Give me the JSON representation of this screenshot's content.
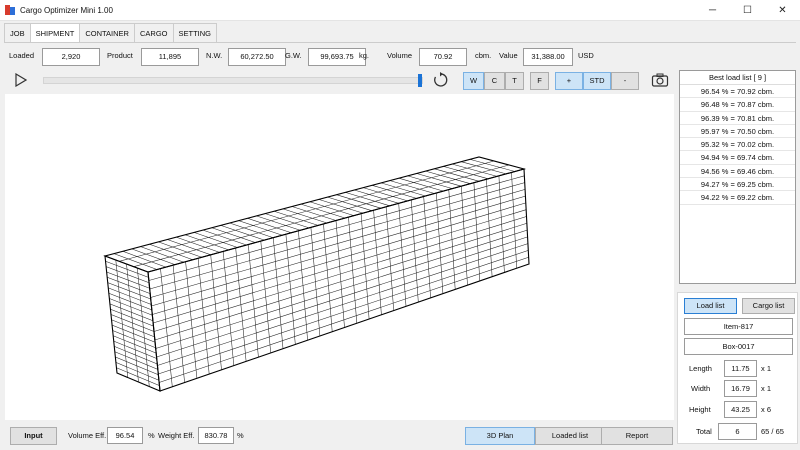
{
  "window": {
    "title": "Cargo Optimizer Mini 1.00",
    "minimize": "─",
    "maximize": "☐",
    "close": "✕"
  },
  "tabs": [
    "JOB",
    "SHIPMENT",
    "CONTAINER",
    "CARGO",
    "SETTING"
  ],
  "active_tab": "SHIPMENT",
  "info": {
    "loaded_label": "Loaded",
    "loaded": "2,920",
    "product_label": "Product",
    "product": "11,895",
    "nw_label": "N.W.",
    "nw": "60,272.50",
    "gw_label": "G.W.",
    "gw": "99,693.75",
    "kg_unit": "kg.",
    "volume_label": "Volume",
    "volume": "70.92",
    "cbm_unit": "cbm.",
    "value_label": "Value",
    "value": "31,388.00",
    "usd_unit": "USD"
  },
  "toolbar": {
    "slider_value": 1.0,
    "view_w": "W",
    "view_c": "C",
    "view_t": "T",
    "view_f": "F",
    "zoom_plus": "+",
    "zoom_std": "STD",
    "zoom_minus": "-"
  },
  "best_load_list": {
    "header": "Best load list [ 9 ]",
    "rows": [
      "96.54 % = 70.92 cbm.",
      "96.48 % = 70.87 cbm.",
      "96.39 % = 70.81 cbm.",
      "95.97 % = 70.50 cbm.",
      "95.32 % = 70.02 cbm.",
      "94.94 % = 69.74 cbm.",
      "94.56 % = 69.46 cbm.",
      "94.27 % = 69.25 cbm.",
      "94.22 % = 69.22 cbm."
    ]
  },
  "panel": {
    "load_list": "Load list",
    "cargo_list": "Cargo list",
    "item": "Item-817",
    "box": "Box-0017",
    "length_label": "Length",
    "length": "11.75",
    "length_mult": "x 1",
    "width_label": "Width",
    "width": "16.79",
    "width_mult": "x 1",
    "height_label": "Height",
    "height": "43.25",
    "height_mult": "x 6",
    "total_label": "Total",
    "total": "6",
    "total_count": "65 / 65"
  },
  "bottom": {
    "input": "Input",
    "vol_eff_label": "Volume Eff.",
    "vol_eff": "96.54",
    "percent1": "%",
    "weight_eff_label": "Weight Eff.",
    "weight_eff": "830.78",
    "percent2": "%",
    "plan3d": "3D Plan",
    "loaded_list": "Loaded list",
    "report": "Report"
  },
  "colors": {
    "accent": "#1b73d6",
    "active_bg": "#cde4f7"
  }
}
